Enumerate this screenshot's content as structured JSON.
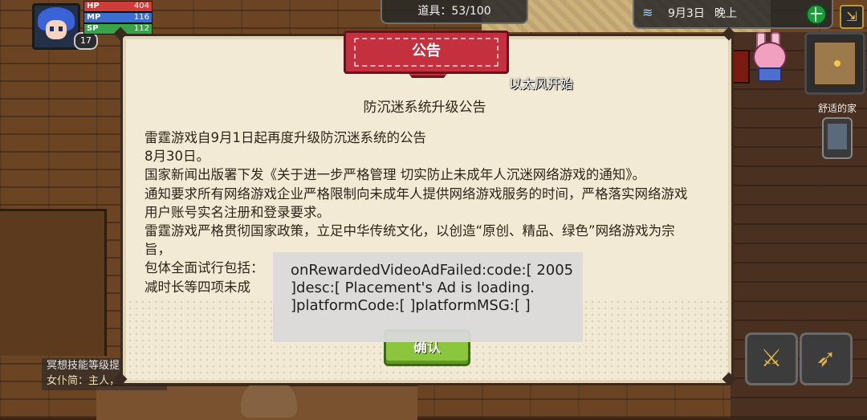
{
  "hud": {
    "player": {
      "hp_label": "HP",
      "hp_value": "404",
      "mp_label": "MP",
      "mp_value": "116",
      "sp_label": "SP",
      "sp_value": "112",
      "level": "17"
    },
    "items_text": "道具：53/100",
    "date_text": "9月3日",
    "time_text": "晚上",
    "location": "舒适的家",
    "colors": {
      "hp": "#d23b3b",
      "mp": "#3b6ed2",
      "sp": "#3aa24a"
    }
  },
  "dialog": {
    "header_title": "公告",
    "scroll_text": "以太风开始",
    "subtitle": "防沉迷系统升级公告",
    "body": [
      "雷霆游戏自9月1日起再度升级防沉迷系统的公告",
      "8月30日。",
      "国家新闻出版署下发《关于进一步严格管理 切实防止未成年人沉迷网络游戏的通知》。",
      "通知要求所有网络游戏企业严格限制向未成年人提供网络游戏服务的时间，严格落实网络游戏用户账号实名注册和登录要求。",
      "雷霆游戏严格贯彻国家政策，立足中华传统文化，以创造“原创、精品、绿色”网络游戏为宗旨，",
      "包体全面试行包括：",
      "减时长等四项未成"
    ],
    "confirm_label": "确认"
  },
  "toast": {
    "text": "onRewardedVideoAdFailed:code:[ 2005 ]desc:[ Placement's Ad is loading. ]platformCode:[ ]platformMSG:[ ]"
  },
  "message_log": {
    "line1": "冥想技能等级提",
    "line2": "女仆简：主人，您回来啦"
  },
  "icons": {
    "weather": "wave-icon",
    "globe": "globe-icon",
    "exit": "exit-icon",
    "sword": "sword-skill-icon",
    "bow": "bow-skill-icon",
    "phone": "phone-icon"
  }
}
